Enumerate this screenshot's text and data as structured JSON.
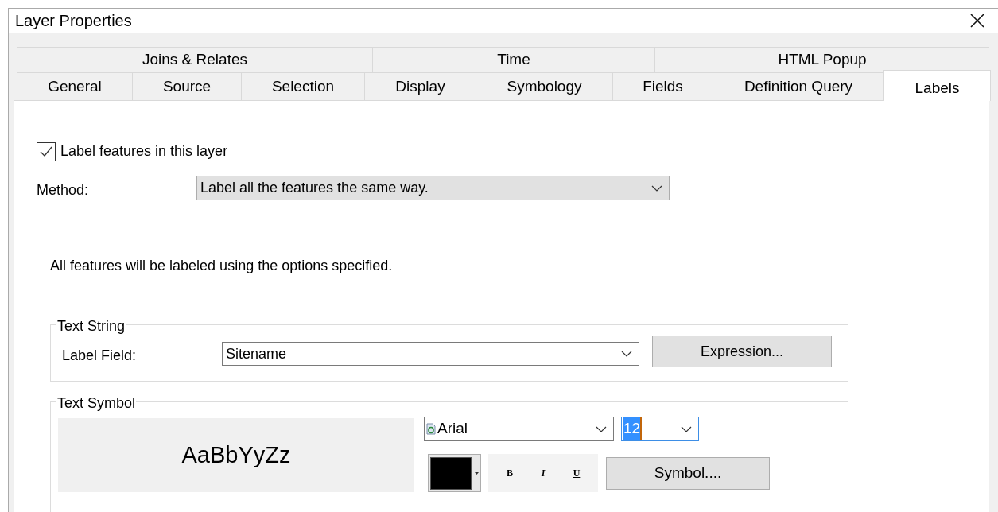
{
  "window": {
    "title": "Layer Properties"
  },
  "tab_rows": [
    [
      {
        "label": "Joins & Relates",
        "selected": false
      },
      {
        "label": "Time",
        "selected": false
      },
      {
        "label": "HTML Popup",
        "selected": false
      }
    ],
    [
      {
        "label": "General",
        "selected": false
      },
      {
        "label": "Source",
        "selected": false
      },
      {
        "label": "Selection",
        "selected": false
      },
      {
        "label": "Display",
        "selected": false
      },
      {
        "label": "Symbology",
        "selected": false
      },
      {
        "label": "Fields",
        "selected": false
      },
      {
        "label": "Definition Query",
        "selected": false
      },
      {
        "label": "Labels",
        "selected": true
      }
    ]
  ],
  "label_checkbox": {
    "label": "Label features in this layer",
    "checked": true
  },
  "method": {
    "label": "Method:",
    "value": "Label all the features the same way."
  },
  "description": "All features will be labeled using the options specified.",
  "text_string": {
    "title": "Text String",
    "label": "Label Field:",
    "value": "Sitename",
    "button": "Expression..."
  },
  "text_symbol": {
    "title": "Text Symbol",
    "preview": "AaBbYyZz",
    "font": "Arial",
    "size": "12",
    "color": "#000000",
    "styles": [
      "B",
      "I",
      "U"
    ],
    "button": "Symbol...."
  }
}
